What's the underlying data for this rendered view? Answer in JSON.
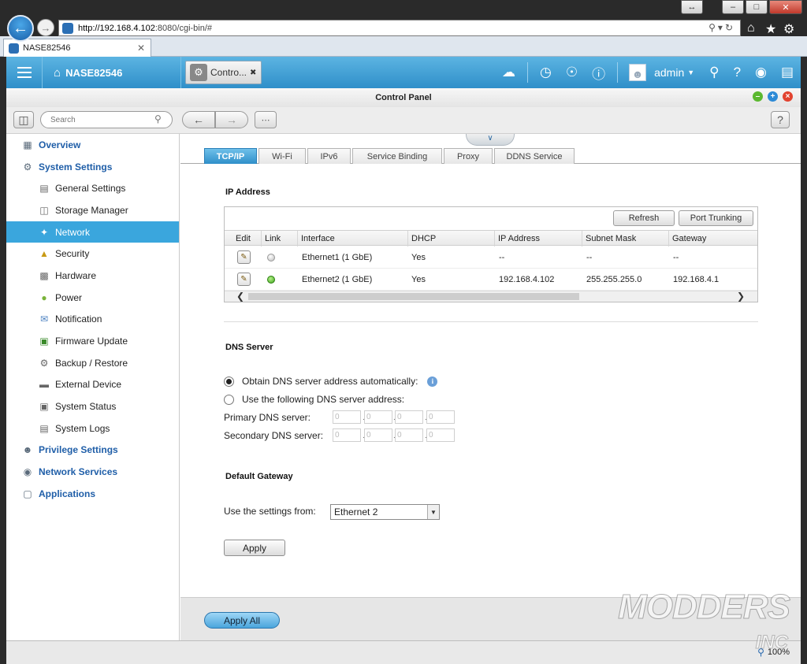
{
  "browser": {
    "url_host": "http://192.168.4.102",
    "url_path": ":8080/cgi-bin/#",
    "tab_title": "NASE82546",
    "zoom": "100%"
  },
  "header": {
    "home_label": "NASE82546",
    "app_tab": "Contro...",
    "user": "admin"
  },
  "window": {
    "title": "Control Panel",
    "search_placeholder": "Search"
  },
  "sidebar": {
    "overview": "Overview",
    "system_settings": "System Settings",
    "sub_items": [
      "General Settings",
      "Storage Manager",
      "Network",
      "Security",
      "Hardware",
      "Power",
      "Notification",
      "Firmware Update",
      "Backup / Restore",
      "External Device",
      "System Status",
      "System Logs"
    ],
    "privilege_settings": "Privilege Settings",
    "network_services": "Network Services",
    "applications": "Applications"
  },
  "tabs": [
    "TCP/IP",
    "Wi-Fi",
    "IPv6",
    "Service Binding",
    "Proxy",
    "DDNS Service"
  ],
  "ip_address": {
    "title": "IP Address",
    "refresh": "Refresh",
    "port_trunking": "Port Trunking",
    "columns": [
      "Edit",
      "Link",
      "Interface",
      "DHCP",
      "IP Address",
      "Subnet Mask",
      "Gateway"
    ],
    "rows": [
      {
        "interface": "Ethernet1 (1 GbE)",
        "dhcp": "Yes",
        "ip": "--",
        "mask": "--",
        "gateway": "--",
        "link": "off"
      },
      {
        "interface": "Ethernet2 (1 GbE)",
        "dhcp": "Yes",
        "ip": "192.168.4.102",
        "mask": "255.255.255.0",
        "gateway": "192.168.4.1",
        "link": "on"
      }
    ]
  },
  "dns": {
    "title": "DNS Server",
    "auto_label": "Obtain DNS server address automatically:",
    "manual_label": "Use the following DNS server address:",
    "primary_label": "Primary DNS server:",
    "secondary_label": "Secondary DNS server:",
    "octet_value": "0"
  },
  "gateway": {
    "title": "Default Gateway",
    "use_from_label": "Use the settings from:",
    "selected": "Ethernet 2"
  },
  "buttons": {
    "apply": "Apply",
    "apply_all": "Apply All"
  },
  "watermark": {
    "line1": "MODDERS",
    "line2": "INC"
  }
}
